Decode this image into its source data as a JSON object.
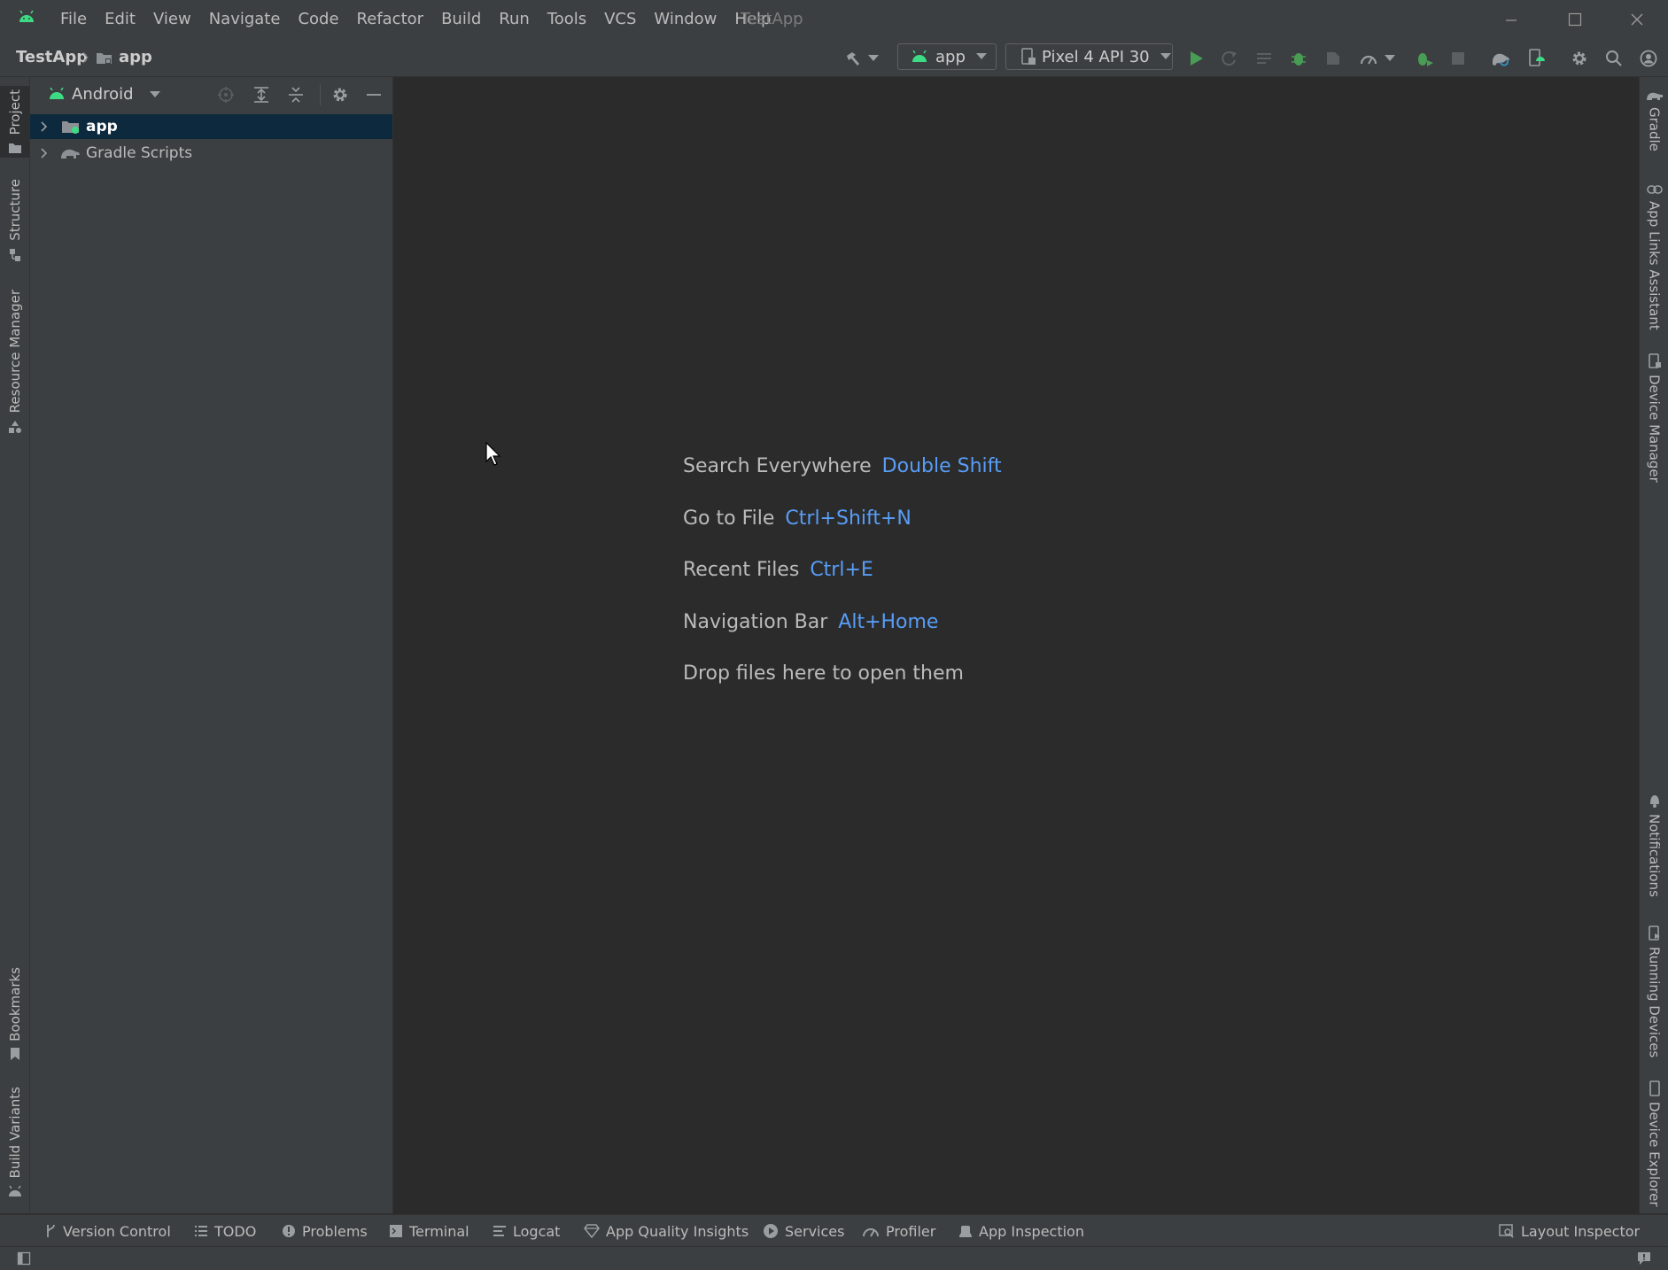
{
  "window": {
    "title": "TestApp",
    "controls": [
      "minimize",
      "maximize",
      "close"
    ]
  },
  "menu": [
    {
      "label": "File"
    },
    {
      "label": "Edit"
    },
    {
      "label": "View"
    },
    {
      "label": "Navigate"
    },
    {
      "label": "Code"
    },
    {
      "label": "Refactor"
    },
    {
      "label": "Build"
    },
    {
      "label": "Run"
    },
    {
      "label": "Tools"
    },
    {
      "label": "VCS"
    },
    {
      "label": "Window"
    },
    {
      "label": "Help"
    }
  ],
  "breadcrumb": {
    "project": "TestApp",
    "module": "app"
  },
  "toolbar": {
    "run_config": "app",
    "device": "Pixel 4 API 30"
  },
  "left_stripe": {
    "project": "Project",
    "structure": "Structure",
    "resource_manager": "Resource Manager",
    "bookmarks": "Bookmarks",
    "build_variants": "Build Variants"
  },
  "project_panel": {
    "view_mode": "Android",
    "tree": [
      {
        "label": "app",
        "selected": true
      },
      {
        "label": "Gradle Scripts",
        "selected": false
      }
    ]
  },
  "editor": {
    "hints": [
      {
        "label": "Search Everywhere",
        "shortcut": "Double Shift"
      },
      {
        "label": "Go to File",
        "shortcut": "Ctrl+Shift+N"
      },
      {
        "label": "Recent Files",
        "shortcut": "Ctrl+E"
      },
      {
        "label": "Navigation Bar",
        "shortcut": "Alt+Home"
      },
      {
        "label": "Drop files here to open them",
        "shortcut": ""
      }
    ]
  },
  "right_stripe": {
    "gradle": "Gradle",
    "app_links": "App Links Assistant",
    "device_manager": "Device Manager",
    "notifications": "Notifications",
    "running_devices": "Running Devices",
    "device_explorer": "Device Explorer"
  },
  "bottom_tabs": {
    "version_control": "Version Control",
    "todo": "TODO",
    "problems": "Problems",
    "terminal": "Terminal",
    "logcat": "Logcat",
    "app_quality": "App Quality Insights",
    "services": "Services",
    "profiler": "Profiler",
    "app_inspection": "App Inspection",
    "layout_inspector": "Layout Inspector"
  },
  "colors": {
    "accent_green": "#3ddc84",
    "shortcut_blue": "#589df6",
    "selection": "#0d293e",
    "panel_bg": "#3c3f41",
    "editor_bg": "#2b2b2b"
  }
}
